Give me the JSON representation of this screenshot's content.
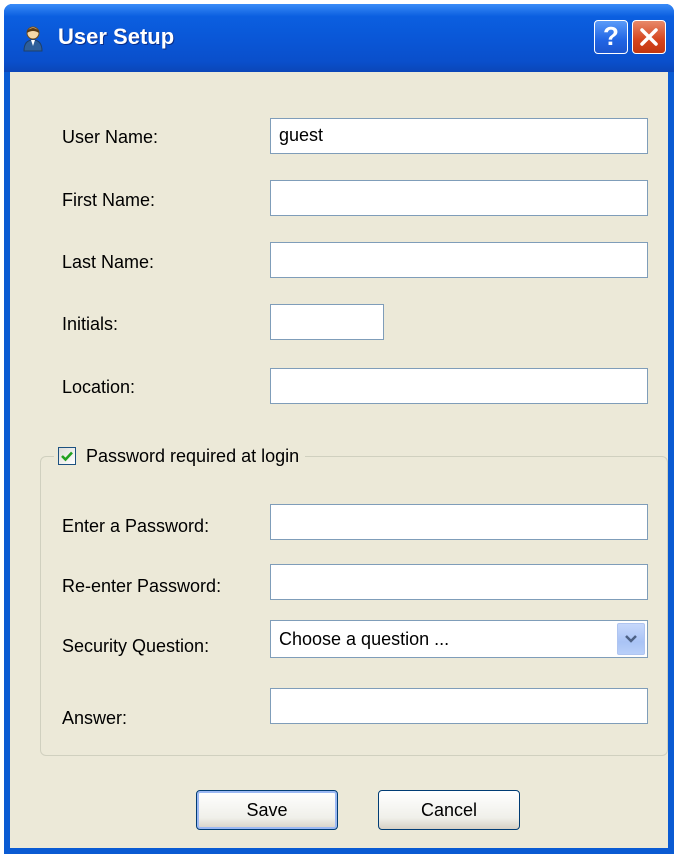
{
  "window": {
    "title": "User Setup",
    "help_glyph": "?",
    "close_glyph": "✕"
  },
  "form": {
    "user_name": {
      "label": "User Name:",
      "value": "guest"
    },
    "first_name": {
      "label": "First Name:",
      "value": ""
    },
    "last_name": {
      "label": "Last Name:",
      "value": ""
    },
    "initials": {
      "label": "Initials:",
      "value": ""
    },
    "location": {
      "label": "Location:",
      "value": ""
    }
  },
  "password_group": {
    "checkbox_label": "Password required at login",
    "checked": true,
    "enter_password": {
      "label": "Enter a Password:",
      "value": ""
    },
    "reenter_password": {
      "label": "Re-enter Password:",
      "value": ""
    },
    "security_question": {
      "label": "Security Question:",
      "selected": "Choose a question ..."
    },
    "answer": {
      "label": "Answer:",
      "value": ""
    }
  },
  "buttons": {
    "save": "Save",
    "cancel": "Cancel"
  },
  "icons": {
    "title": "user-icon",
    "help": "help-icon",
    "close": "close-icon",
    "checkbox": "checkmark-icon",
    "dropdown": "chevron-down-icon"
  },
  "colors": {
    "titlebar": "#0a56d6",
    "client_bg": "#ece9d8",
    "close_button": "#d5441d",
    "input_border": "#7f9db9",
    "checkmark": "#21a121"
  }
}
